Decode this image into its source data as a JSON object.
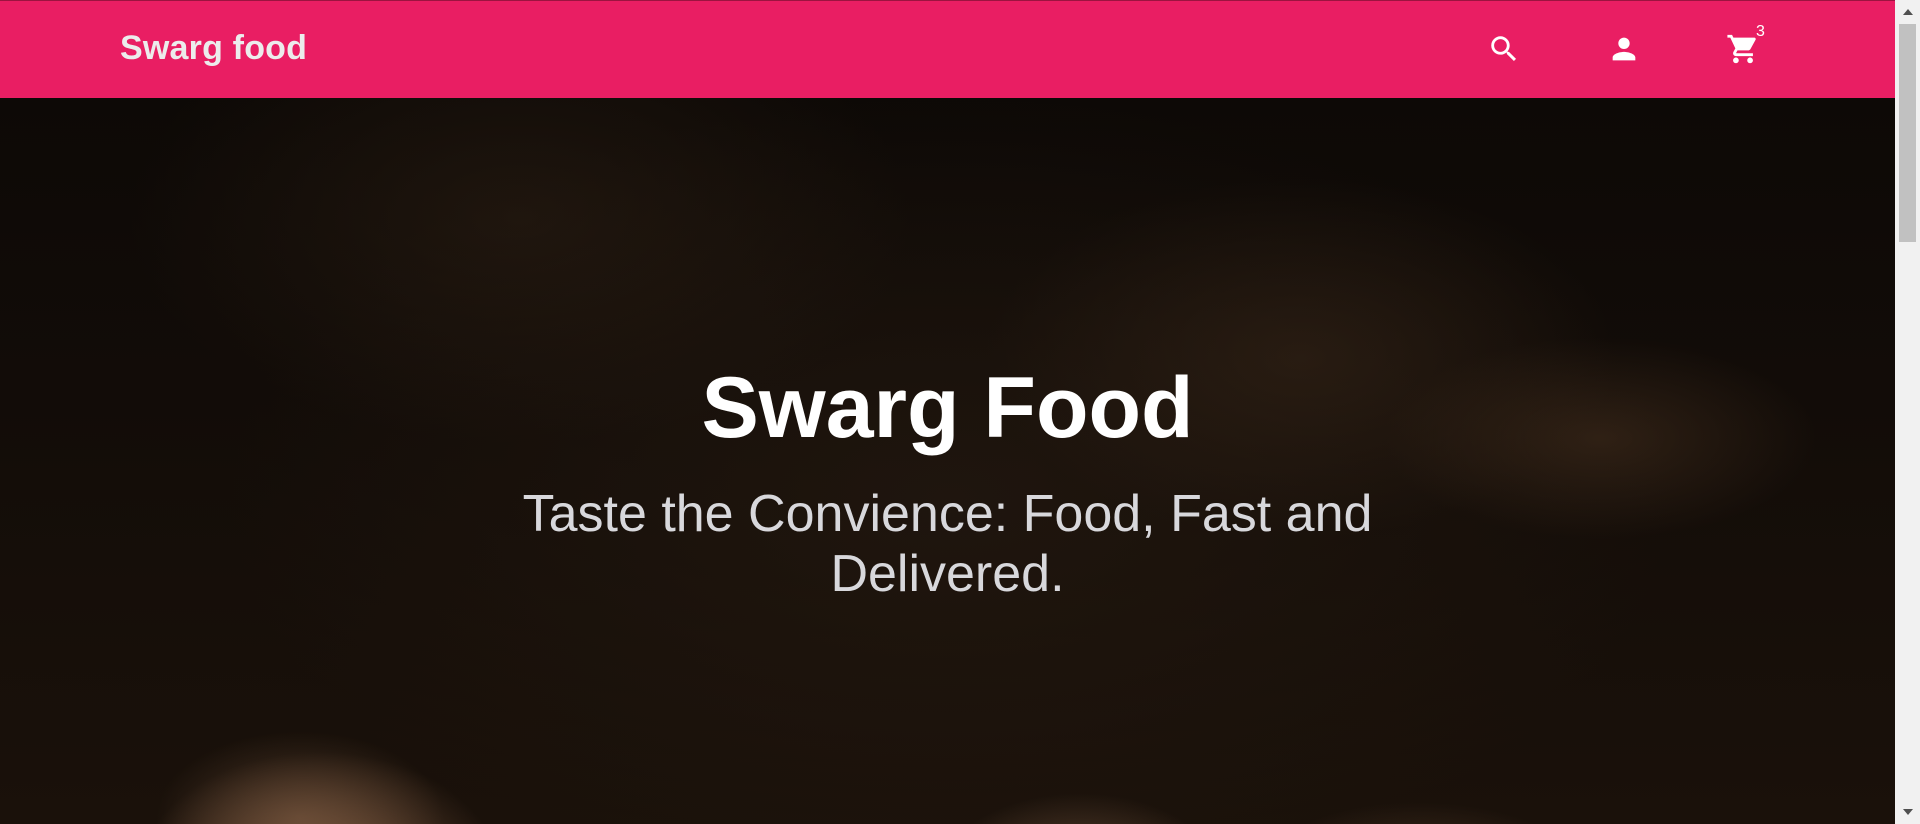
{
  "navbar": {
    "brand": "Swarg food",
    "background_color": "#e91e63",
    "icons": {
      "search": "search-icon",
      "account": "account-icon",
      "cart": "shopping-cart-icon"
    },
    "cart_count": "3"
  },
  "hero": {
    "title": "Swarg Food",
    "subtitle": "Taste the Convience: Food, Fast and Delivered."
  },
  "scrollbar": {
    "icons": {
      "up": "scroll-up-arrow-icon",
      "down": "scroll-down-arrow-icon"
    }
  }
}
